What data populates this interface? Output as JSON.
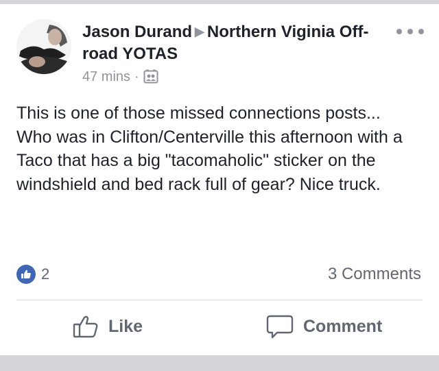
{
  "post": {
    "author": "Jason Durand",
    "group": "Northern Viginia Off-road YOTAS",
    "time": "47 mins",
    "separator": "·",
    "body_lines": [
      "This is one of those missed connections posts...",
      "Who was in Clifton/Centerville this afternoon with a Taco that has a big \"tacomaholic\" sticker on the windshield and bed rack full of gear? Nice truck."
    ]
  },
  "stats": {
    "like_count": "2",
    "comments": "3 Comments"
  },
  "actions": {
    "like_label": "Like",
    "comment_label": "Comment"
  },
  "icons": {
    "more": "more-options-icon",
    "privacy": "group-audience-icon",
    "like_badge": "thumbs-up-icon",
    "like_action": "thumbs-up-outline-icon",
    "comment_action": "speech-bubble-icon"
  },
  "colors": {
    "like_badge": "#4267b2",
    "secondary_text": "#90949c",
    "action_text": "#616770"
  }
}
